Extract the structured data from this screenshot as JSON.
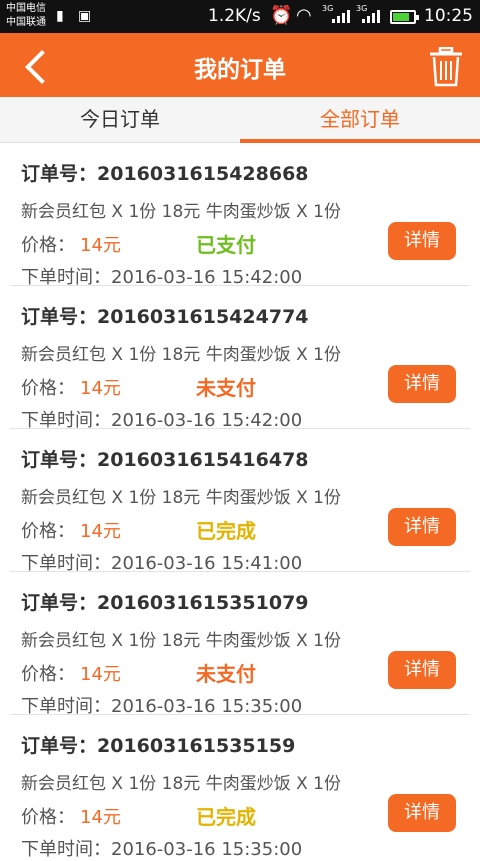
{
  "statusbar": {
    "carrier1": "中国电信",
    "carrier2": "中国联通",
    "speed": "1.2K/s",
    "net1": "3G",
    "net2": "3G",
    "time": "10:25"
  },
  "nav": {
    "title": "我的订单"
  },
  "tabs": [
    {
      "label": "今日订单",
      "active": false
    },
    {
      "label": "全部订单",
      "active": true
    }
  ],
  "colors": {
    "accent": "#f46a24",
    "paid": "#6fbe1f",
    "unpaid": "#f46a24",
    "done": "#e2b400"
  },
  "orders": [
    {
      "order_no": "订单号：201603161542866​8",
      "items": "新会员红包 X 1份 18元 牛肉蛋炒饭 X 1份",
      "price_label": "价格：",
      "price": "14元",
      "status": "已支付",
      "status_color": "#6fbe1f",
      "time": "下单时间：2016-03-16 15:42:00",
      "detail": "详情"
    },
    {
      "order_no": "订单号：201603161542477​4",
      "items": "新会员红包 X 1份 18元 牛肉蛋炒饭 X 1份",
      "price_label": "价格：",
      "price": "14元",
      "status": "未支付",
      "status_color": "#f46a24",
      "time": "下单时间：2016-03-16 15:42:00",
      "detail": "详情"
    },
    {
      "order_no": "订单号：201603161541647​8",
      "items": "新会员红包 X 1份 18元 牛肉蛋炒饭 X 1份",
      "price_label": "价格：",
      "price": "14元",
      "status": "已完成",
      "status_color": "#e2b400",
      "time": "下单时间：2016-03-16 15:41:00",
      "detail": "详情"
    },
    {
      "order_no": "订单号：201603161535107​9",
      "items": "新会员红包 X 1份 18元 牛肉蛋炒饭 X 1份",
      "price_label": "价格：",
      "price": "14元",
      "status": "未支付",
      "status_color": "#f46a24",
      "time": "下单时间：2016-03-16 15:35:00",
      "detail": "详情"
    },
    {
      "order_no": "订单号：201603161535159",
      "items": "新会员红包 X 1份 18元 牛肉蛋炒饭 X 1份",
      "price_label": "价格：",
      "price": "14元",
      "status": "已完成",
      "status_color": "#e2b400",
      "time": "下单时间：2016-03-16 15:35:00",
      "detail": "详情"
    }
  ]
}
